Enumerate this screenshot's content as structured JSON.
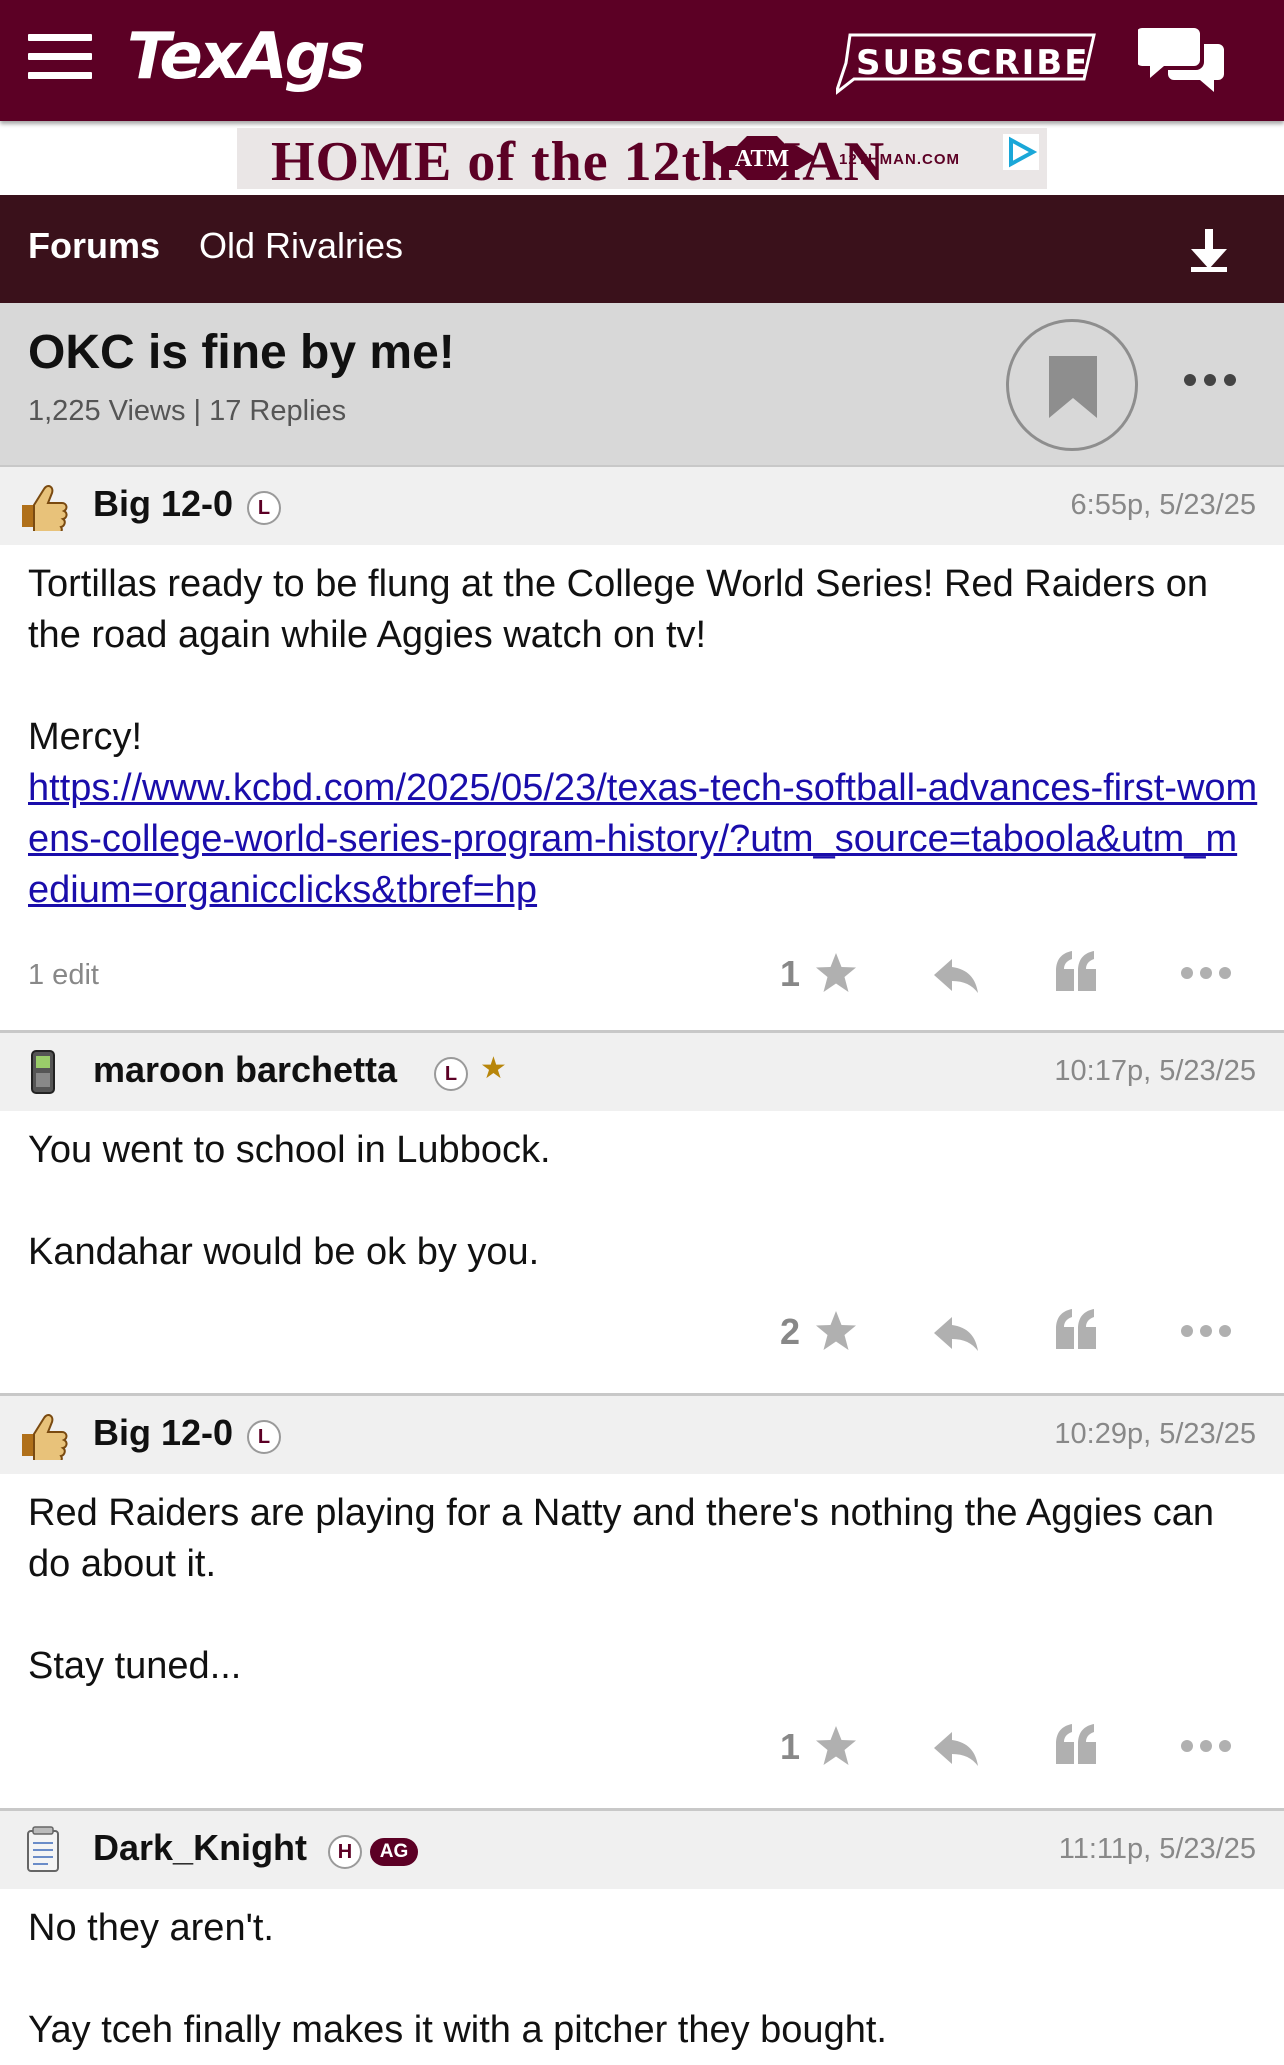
{
  "header": {
    "logo": "TexAgs",
    "subscribe_label": "SUBSCRIBE"
  },
  "ad": {
    "text": "HOME of the 12th MAN",
    "url": "12THMAN.COM"
  },
  "breadcrumb": {
    "forums": "Forums",
    "board": "Old Rivalries"
  },
  "thread": {
    "title": "OKC is fine by me!",
    "meta": "1,225 Views | 17 Replies"
  },
  "posts": [
    {
      "author": "Big 12-0",
      "badge": "L",
      "time": "6:55p, 5/23/25",
      "line1": "Tortillas ready to be flung at the College World Series! Red Raiders on the road again while Aggies watch on tv!",
      "line2": "Mercy!",
      "link": "https://www.kcbd.com/2025/05/23/texas-tech-softball-advances-first-womens-college-world-series-program-history/?utm_source=taboola&utm_medium=organicclicks&tbref=hp",
      "edit": "1 edit",
      "likes": "1"
    },
    {
      "author": "maroon barchetta",
      "badge": "L",
      "star": "★",
      "time": "10:17p, 5/23/25",
      "line1": "You went to school in Lubbock.",
      "line2": "Kandahar would be ok by you.",
      "likes": "2"
    },
    {
      "author": "Big 12-0",
      "badge": "L",
      "time": "10:29p, 5/23/25",
      "line1": "Red Raiders are playing for a Natty and there's nothing the Aggies can do about it.",
      "line2": "Stay tuned...",
      "likes": "1"
    },
    {
      "author": "Dark_Knight",
      "badge": "H",
      "badge2": "AG",
      "time": "11:11p, 5/23/25",
      "line1": "No they aren't.",
      "line2": "Yay tceh finally makes it with a pitcher they bought."
    }
  ],
  "colors": {
    "brand_maroon": "#5c0025",
    "crumb_bar": "#3a111b",
    "link": "#1a0dab"
  }
}
